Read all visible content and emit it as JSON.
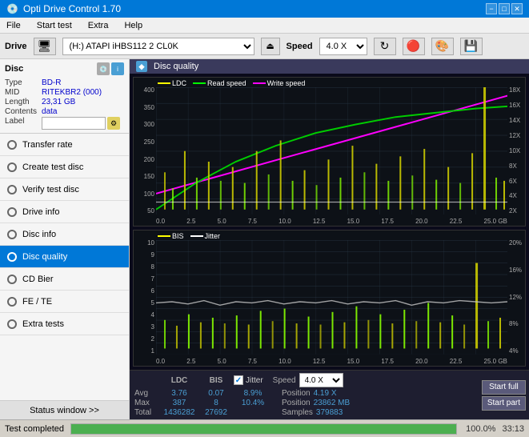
{
  "titleBar": {
    "title": "Opti Drive Control 1.70",
    "minBtn": "−",
    "maxBtn": "□",
    "closeBtn": "✕"
  },
  "menuBar": {
    "items": [
      "File",
      "Start test",
      "Extra",
      "Help"
    ]
  },
  "driveBar": {
    "label": "Drive",
    "driveValue": "(H:) ATAPI iHBS112 2 CL0K",
    "speedLabel": "Speed",
    "speedValue": "4.0 X"
  },
  "disc": {
    "title": "Disc",
    "typeLabel": "Type",
    "typeValue": "BD-R",
    "midLabel": "MID",
    "midValue": "RITEKBR2 (000)",
    "lengthLabel": "Length",
    "lengthValue": "23,31 GB",
    "contentsLabel": "Contents",
    "contentsValue": "data",
    "labelLabel": "Label",
    "labelValue": ""
  },
  "navItems": [
    {
      "id": "transfer-rate",
      "label": "Transfer rate",
      "active": false
    },
    {
      "id": "create-test-disc",
      "label": "Create test disc",
      "active": false
    },
    {
      "id": "verify-test-disc",
      "label": "Verify test disc",
      "active": false
    },
    {
      "id": "drive-info",
      "label": "Drive info",
      "active": false
    },
    {
      "id": "disc-info",
      "label": "Disc info",
      "active": false
    },
    {
      "id": "disc-quality",
      "label": "Disc quality",
      "active": true
    },
    {
      "id": "cd-bier",
      "label": "CD Bier",
      "active": false
    },
    {
      "id": "fe-te",
      "label": "FE / TE",
      "active": false
    },
    {
      "id": "extra-tests",
      "label": "Extra tests",
      "active": false
    }
  ],
  "statusWindow": "Status window >>",
  "qualityHeader": "Disc quality",
  "chart1": {
    "legend": [
      {
        "color": "#ffff00",
        "label": "LDC"
      },
      {
        "color": "#00ff00",
        "label": "Read speed"
      },
      {
        "color": "#ff00ff",
        "label": "Write speed"
      }
    ],
    "yLabels": [
      "400",
      "350",
      "300",
      "250",
      "200",
      "150",
      "100",
      "50"
    ],
    "yLabelsRight": [
      "18X",
      "16X",
      "14X",
      "12X",
      "10X",
      "8X",
      "6X",
      "4X",
      "2X"
    ],
    "xLabels": [
      "0.0",
      "2.5",
      "5.0",
      "7.5",
      "10.0",
      "12.5",
      "15.0",
      "17.5",
      "20.0",
      "22.5",
      "25.0 GB"
    ]
  },
  "chart2": {
    "legend": [
      {
        "color": "#ffff00",
        "label": "BIS"
      },
      {
        "color": "#ffffff",
        "label": "Jitter"
      }
    ],
    "yLabels": [
      "10",
      "9",
      "8",
      "7",
      "6",
      "5",
      "4",
      "3",
      "2",
      "1"
    ],
    "yLabelsRight": [
      "20%",
      "16%",
      "12%",
      "8%",
      "4%"
    ],
    "xLabels": [
      "0.0",
      "2.5",
      "5.0",
      "7.5",
      "10.0",
      "12.5",
      "15.0",
      "17.5",
      "20.0",
      "22.5",
      "25.0 GB"
    ]
  },
  "stats": {
    "headers": {
      "ldc": "LDC",
      "bis": "BIS",
      "jitter": "Jitter",
      "speed": "Speed",
      "position": "Position",
      "samples": "Samples"
    },
    "avg": {
      "label": "Avg",
      "ldc": "3.76",
      "bis": "0.07",
      "jitter": "8.9%"
    },
    "max": {
      "label": "Max",
      "ldc": "387",
      "bis": "8",
      "jitter": "10.4%",
      "speedVal": "4.19 X"
    },
    "total": {
      "label": "Total",
      "ldc": "1436282",
      "bis": "27692"
    },
    "speedDisplay": "4.0 X",
    "positionVal": "23862 MB",
    "samplesVal": "379883",
    "startFull": "Start full",
    "startPart": "Start part",
    "jitterChecked": true,
    "jitterLabel": "Jitter"
  },
  "bottomBar": {
    "progressLabel": "Test completed",
    "progressPct": "100.0%",
    "time": "33:13"
  }
}
